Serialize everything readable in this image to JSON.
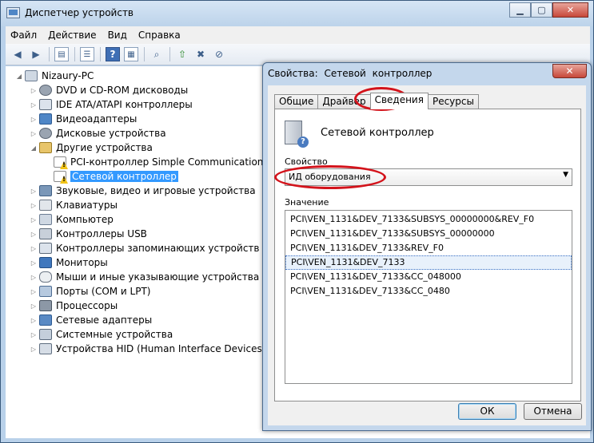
{
  "main_window": {
    "title": "Диспетчер устройств",
    "controls": {
      "minimize": "▁",
      "maximize": "▢",
      "close": "✕"
    },
    "menu": [
      "Файл",
      "Действие",
      "Вид",
      "Справка"
    ],
    "toolbar_icons": [
      "back-icon",
      "forward-icon",
      "show-hide-console-tree-icon",
      "properties-icon",
      "help-icon",
      "scan-hardware-icon",
      "update-driver-icon",
      "uninstall-icon",
      "disable-icon"
    ]
  },
  "tree": {
    "root": "Nizaury-PC",
    "categories": [
      "DVD и CD-ROM дисководы",
      "IDE ATA/ATAPI контроллеры",
      "Видеоадаптеры",
      "Дисковые устройства",
      "Другие устройства",
      "PCI-контроллер Simple Communications",
      "Сетевой контроллер",
      "Звуковые, видео и игровые устройства",
      "Клавиатуры",
      "Компьютер",
      "Контроллеры USB",
      "Контроллеры запоминающих устройств",
      "Мониторы",
      "Мыши и иные указывающие устройства",
      "Порты (COM и LPT)",
      "Процессоры",
      "Сетевые адаптеры",
      "Системные устройства",
      "Устройства HID (Human Interface Devices)"
    ]
  },
  "dialog": {
    "title_parts": [
      "Свойства:",
      "Сетевой",
      "контроллер"
    ],
    "close": "✕",
    "tabs": [
      "Общие",
      "Драйвер",
      "Сведения",
      "Ресурсы"
    ],
    "active_tab": "Сведения",
    "device_name": "Сетевой контроллер",
    "property_label": "Свойство",
    "property_value": "ИД оборудования",
    "value_label": "Значение",
    "values": [
      "PCI\\VEN_1131&DEV_7133&SUBSYS_00000000&REV_F0",
      "PCI\\VEN_1131&DEV_7133&SUBSYS_00000000",
      "PCI\\VEN_1131&DEV_7133&REV_F0",
      "PCI\\VEN_1131&DEV_7133",
      "PCI\\VEN_1131&DEV_7133&CC_048000",
      "PCI\\VEN_1131&DEV_7133&CC_0480"
    ],
    "focused_value_index": 3,
    "ok": "ОК",
    "cancel": "Отмена"
  },
  "colors": {
    "highlight_annotation": "#d3131b",
    "selection": "#3399ff"
  }
}
